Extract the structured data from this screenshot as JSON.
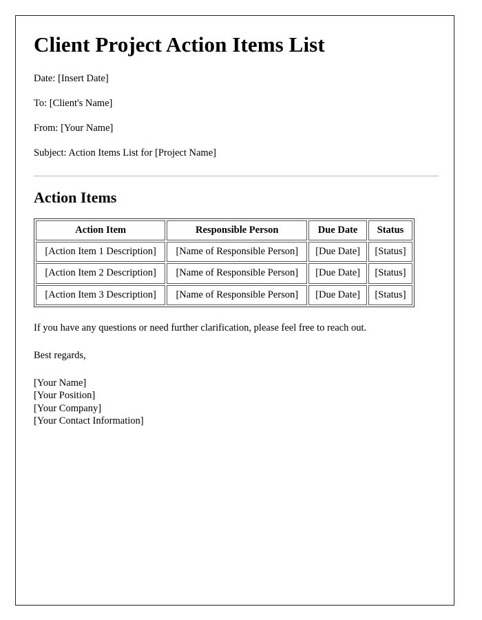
{
  "document": {
    "title": "Client Project Action Items List",
    "meta": [
      {
        "label": "Date",
        "text": "Date: [Insert Date]"
      },
      {
        "label": "To",
        "text": "To: [Client's Name]"
      },
      {
        "label": "From",
        "text": "From: [Your Name]"
      },
      {
        "label": "Subject",
        "text": "Subject: Action Items List for [Project Name]"
      }
    ],
    "section_heading": "Action Items",
    "table": {
      "headers": [
        "Action Item",
        "Responsible Person",
        "Due Date",
        "Status"
      ],
      "rows": [
        [
          "[Action Item 1 Description]",
          "[Name of Responsible Person]",
          "[Due Date]",
          "[Status]"
        ],
        [
          "[Action Item 2 Description]",
          "[Name of Responsible Person]",
          "[Due Date]",
          "[Status]"
        ],
        [
          "[Action Item 3 Description]",
          "[Name of Responsible Person]",
          "[Due Date]",
          "[Status]"
        ]
      ]
    },
    "closing_paragraph": "If you have any questions or need further clarification, please feel free to reach out.",
    "regards": "Best regards,",
    "signature": [
      "[Your Name]",
      "[Your Position]",
      "[Your Company]",
      "[Your Contact Information]"
    ]
  },
  "colors": {
    "page_background": "#ffffff",
    "text": "#000000",
    "page_border": "#222222",
    "divider": "#b9b9b9",
    "table_outer_border": "#3a3a3a",
    "table_cell_border": "#5a5a5a"
  }
}
